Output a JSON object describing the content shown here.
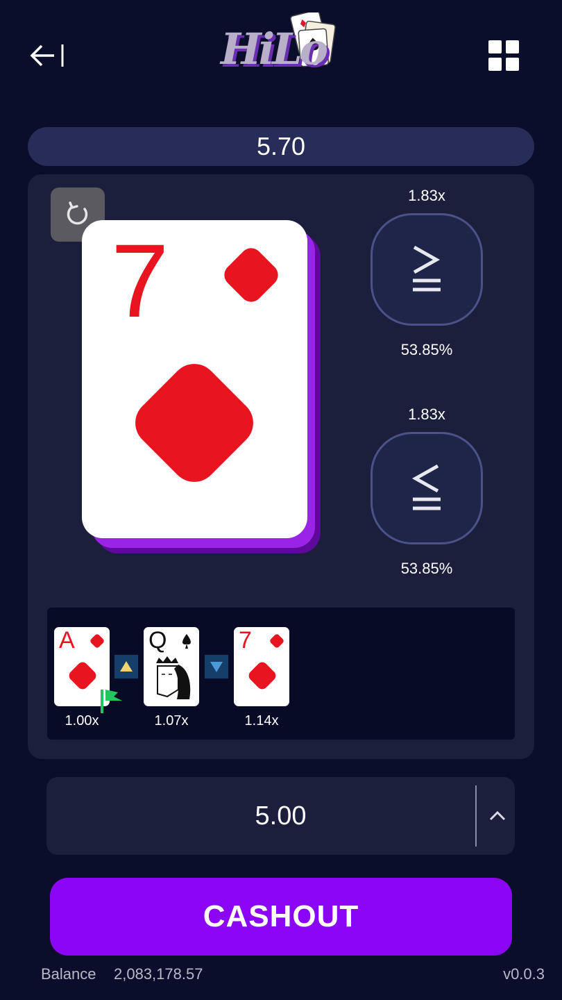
{
  "header": {
    "back_icon": "arrow-left-bar-icon",
    "logo_text": "HiLo",
    "menu_icon": "grid-icon"
  },
  "payout": "5.70",
  "current_card": {
    "rank": "7",
    "suit": "diamonds",
    "color": "#e8141f"
  },
  "bets": {
    "higher": {
      "multiplier": "1.83x",
      "probability": "53.85%",
      "icon": "greater-equal-icon"
    },
    "lower": {
      "multiplier": "1.83x",
      "probability": "53.85%",
      "icon": "less-equal-icon"
    }
  },
  "history": [
    {
      "rank": "A",
      "suit": "diamonds",
      "multiplier": "1.00x",
      "start_flag": true
    },
    {
      "direction": "up"
    },
    {
      "rank": "Q",
      "suit": "spades",
      "multiplier": "1.07x"
    },
    {
      "direction": "down"
    },
    {
      "rank": "7",
      "suit": "diamonds",
      "multiplier": "1.14x"
    }
  ],
  "bet_amount": "5.00",
  "cashout_label": "CASHOUT",
  "footer": {
    "balance_label": "Balance",
    "balance_value": "2,083,178.57",
    "version": "v0.0.3"
  },
  "colors": {
    "background": "#0b0e2b",
    "panel": "#1c1f3c",
    "accent_purple": "#8a06f5",
    "card_red": "#e8141f",
    "flag_green": "#22c55e"
  }
}
